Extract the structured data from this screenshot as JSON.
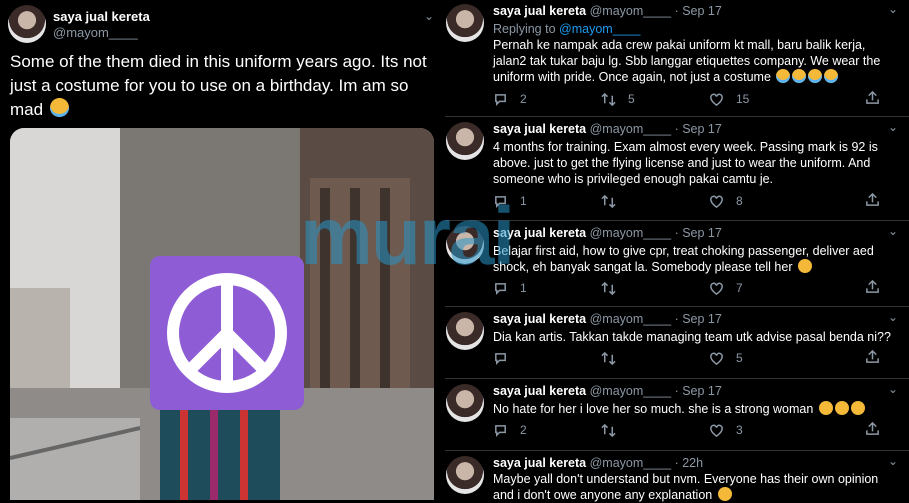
{
  "main_tweet": {
    "name": "saya jual kereta",
    "handle": "@mayom____",
    "text": "Some of the them died in this uniform years ago. Its not just a costume for you to use on a birthday. Im am so mad"
  },
  "watermark": "murai",
  "replies": [
    {
      "name": "saya jual kereta",
      "handle": "@mayom____",
      "time": "· Sep 17",
      "replying_prefix": "Replying to",
      "replying_to": "@mayom____",
      "text": "Pernah ke nampak ada crew pakai uniform kt mall, baru balik kerja, jalan2 tak tukar baju lg. Sbb langgar etiquettes company. We wear the uniform with pride. Once again, not just a costume",
      "replies": "2",
      "retweets": "5",
      "likes": "15"
    },
    {
      "name": "saya jual kereta",
      "handle": "@mayom____",
      "time": "· Sep 17",
      "text": "4 months for training. Exam almost every week. Passing mark is 92 is above. just to get the flying license and just to wear the uniform. And someone who is privileged enough pakai camtu je.",
      "replies": "1",
      "retweets": "",
      "likes": "8"
    },
    {
      "name": "saya jual kereta",
      "handle": "@mayom____",
      "time": "· Sep 17",
      "text": "Belajar first aid, how to give cpr, treat choking passenger, deliver aed shock, eh banyak sangat la. Somebody please tell her",
      "replies": "1",
      "retweets": "",
      "likes": "7"
    },
    {
      "name": "saya jual kereta",
      "handle": "@mayom____",
      "time": "· Sep 17",
      "text": "Dia kan artis. Takkan takde managing team utk advise pasal benda ni??",
      "replies": "",
      "retweets": "",
      "likes": "5"
    },
    {
      "name": "saya jual kereta",
      "handle": "@mayom____",
      "time": "· Sep 17",
      "text": "No hate for her i love her so much. she is a strong woman",
      "replies": "2",
      "retweets": "",
      "likes": "3"
    },
    {
      "name": "saya jual kereta",
      "handle": "@mayom____",
      "time": "· 22h",
      "text": "Maybe yall don't understand but nvm. Everyone has their own opinion and i don't owe anyone any explanation",
      "replies": "",
      "retweets": "",
      "likes": ""
    }
  ],
  "colors": {
    "background": "#000000",
    "muted": "#8b98a5",
    "link": "#1d9bf0",
    "peace_purple": "#8e5dd6"
  }
}
